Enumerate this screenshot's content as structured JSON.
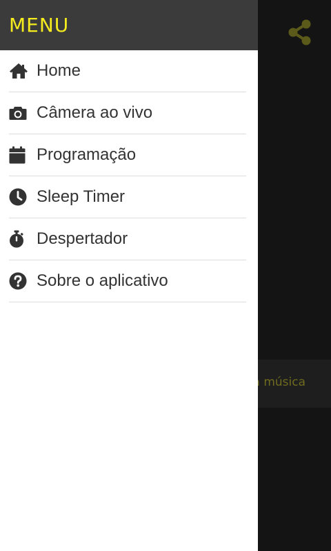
{
  "drawer": {
    "title": "MENU",
    "items": [
      {
        "label": "Home",
        "icon": "home-icon"
      },
      {
        "label": "Câmera ao vivo",
        "icon": "camera-icon"
      },
      {
        "label": "Programação",
        "icon": "calendar-icon"
      },
      {
        "label": "Sleep Timer",
        "icon": "clock-icon"
      },
      {
        "label": "Despertador",
        "icon": "stopwatch-icon"
      },
      {
        "label": "Sobre o aplicativo",
        "icon": "question-circle-icon"
      }
    ]
  },
  "background_app": {
    "share_icon": "share-icon",
    "now_playing_text": "a música"
  },
  "colors": {
    "header_bg": "#3c3b3c",
    "accent_yellow": "#f4ec1e",
    "dim_accent": "#5c5a1a",
    "overlay_bg": "#141414"
  }
}
